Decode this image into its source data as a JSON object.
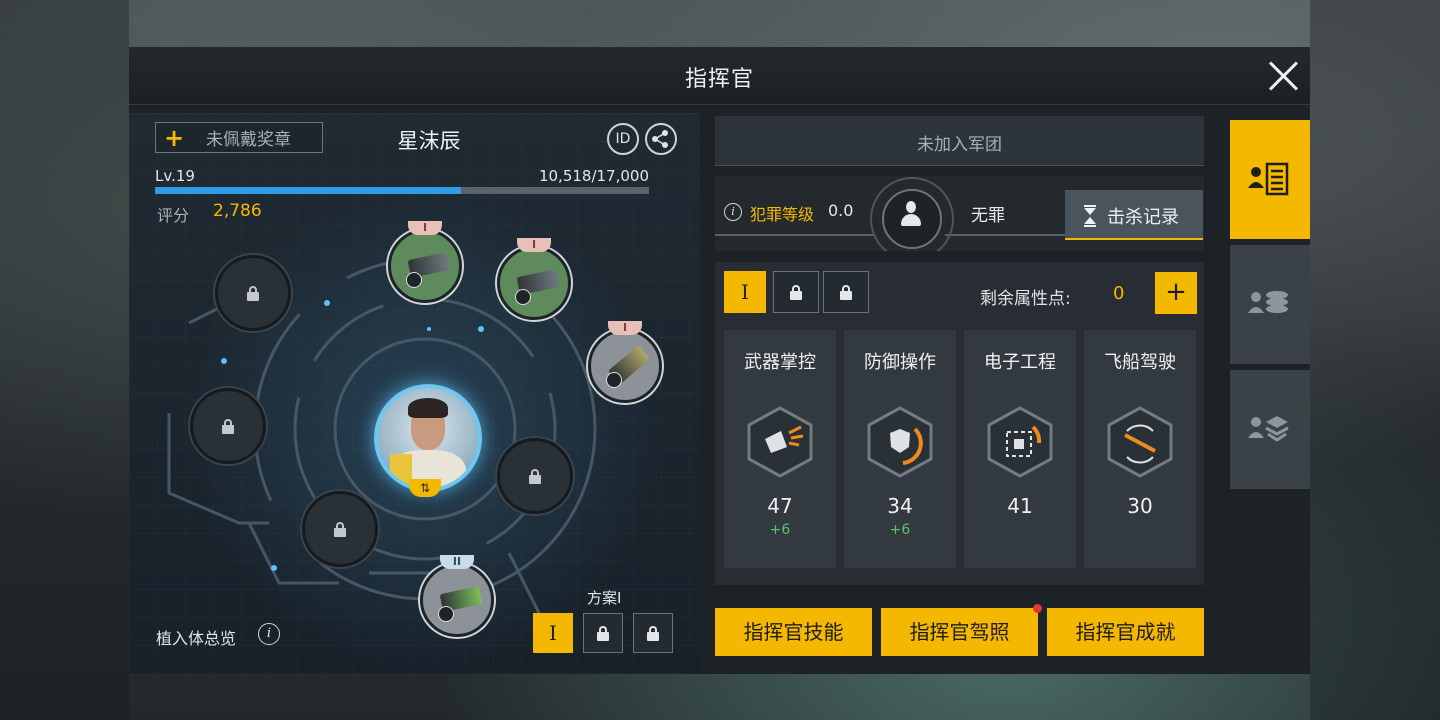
{
  "window": {
    "title": "指挥官",
    "close_icon": "close-icon"
  },
  "profile": {
    "medal_plus": "+",
    "medal_label": "未佩戴奖章",
    "name": "星沫辰",
    "id_label": "ID",
    "level": "Lv.19",
    "xp_text": "10,518/17,000",
    "xp_progress": 0.619,
    "score_label": "评分",
    "score_value": "2,786"
  },
  "implants": {
    "slots": [
      {
        "state": "equipped",
        "tier": "I",
        "color": "green"
      },
      {
        "state": "equipped",
        "tier": "I",
        "color": "green"
      },
      {
        "state": "equipped",
        "tier": "I",
        "color": "grey"
      },
      {
        "state": "locked"
      },
      {
        "state": "locked"
      },
      {
        "state": "locked"
      },
      {
        "state": "locked"
      },
      {
        "state": "equipped",
        "tier": "II",
        "color": "grey"
      }
    ],
    "overview_label": "植入体总览",
    "info_icon": "i",
    "plan_label": "方案I",
    "plan_buttons": [
      {
        "label": "I",
        "state": "active"
      },
      {
        "label": "",
        "state": "locked"
      },
      {
        "label": "",
        "state": "locked"
      }
    ]
  },
  "legion": {
    "label": "未加入军团"
  },
  "crime": {
    "info_icon": "i",
    "level_label": "犯罪等级",
    "level_value": "0.0",
    "status": "无罪",
    "kill_record_label": "击杀记录"
  },
  "attributes": {
    "tier_buttons": [
      {
        "label": "I",
        "state": "active"
      },
      {
        "label": "",
        "state": "locked"
      },
      {
        "label": "",
        "state": "locked"
      }
    ],
    "remaining_label": "剩余属性点:",
    "remaining_value": "0",
    "plus_label": "+",
    "items": [
      {
        "name": "武器掌控",
        "value": "47",
        "bonus": "+6",
        "icon": "weapon-icon"
      },
      {
        "name": "防御操作",
        "value": "34",
        "bonus": "+6",
        "icon": "shield-icon"
      },
      {
        "name": "电子工程",
        "value": "41",
        "bonus": "",
        "icon": "chip-icon"
      },
      {
        "name": "飞船驾驶",
        "value": "30",
        "bonus": "",
        "icon": "ship-icon"
      }
    ]
  },
  "actions": {
    "skills": "指挥官技能",
    "license": "指挥官驾照",
    "achievements": "指挥官成就"
  },
  "colors": {
    "accent": "#f5b800",
    "xp_bar": "#2d9de6",
    "bonus": "#5fbf6b",
    "notify": "#e33a2c"
  }
}
